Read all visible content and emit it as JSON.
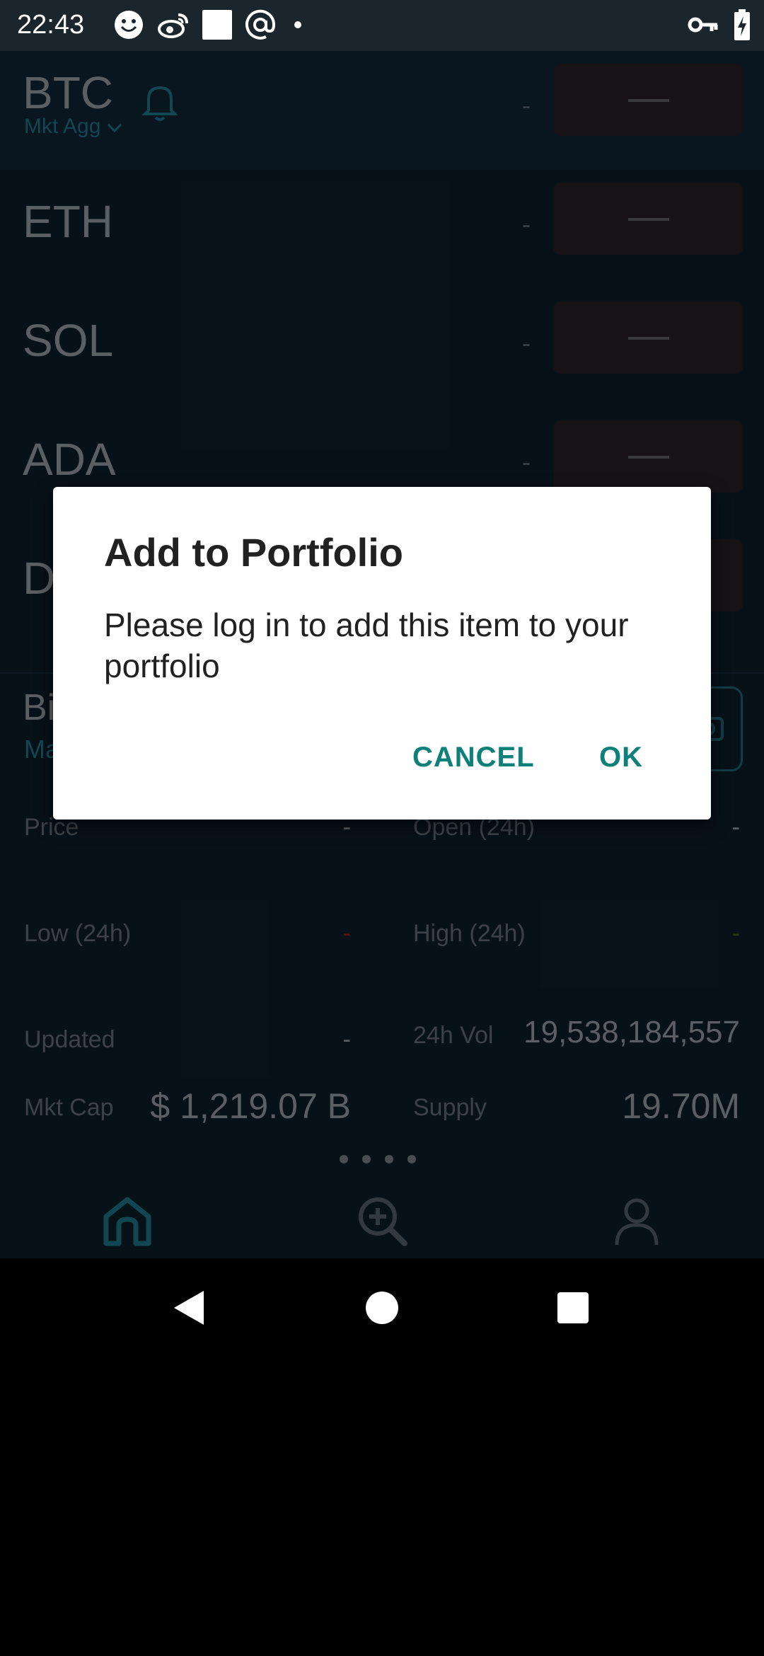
{
  "status_bar": {
    "time": "22:43",
    "icons": [
      "smiley-icon",
      "weibo-icon",
      "white-square-icon",
      "at-sign-icon",
      "dot-icon"
    ],
    "right_icons": [
      "key-icon",
      "battery-charging-icon"
    ]
  },
  "coins": [
    {
      "symbol": "BTC",
      "sub": "Mkt Agg",
      "value": "-"
    },
    {
      "symbol": "ETH",
      "value": "-"
    },
    {
      "symbol": "SOL",
      "value": "-"
    },
    {
      "symbol": "ADA",
      "value": "-"
    },
    {
      "symbol": "D"
    }
  ],
  "detail": {
    "title": "Bi",
    "subtitle": "Ma",
    "price_label": "Price",
    "price_value": "-",
    "open_label": "Open (24h)",
    "open_value": "-",
    "low_label": "Low (24h)",
    "low_value": "-",
    "high_label": "High (24h)",
    "high_value": "-",
    "updated_label": "Updated",
    "updated_value": "-",
    "vol_label": "24h Vol",
    "vol_value": "19,538,184,557",
    "mktcap_label": "Mkt Cap",
    "mktcap_value": "$ 1,219.07 B",
    "supply_label": "Supply",
    "supply_value": "19.70M"
  },
  "bottom_nav": [
    "home-icon",
    "search-add-icon",
    "profile-icon"
  ],
  "dialog": {
    "title": "Add to Portfolio",
    "message": "Please log in to add this item to your portfolio",
    "cancel_label": "CANCEL",
    "ok_label": "OK"
  },
  "colors": {
    "accent": "#0e807a",
    "app_bg": "#0b1b26",
    "down_red": "#8b1e1e",
    "up_green": "#3a5a22"
  }
}
